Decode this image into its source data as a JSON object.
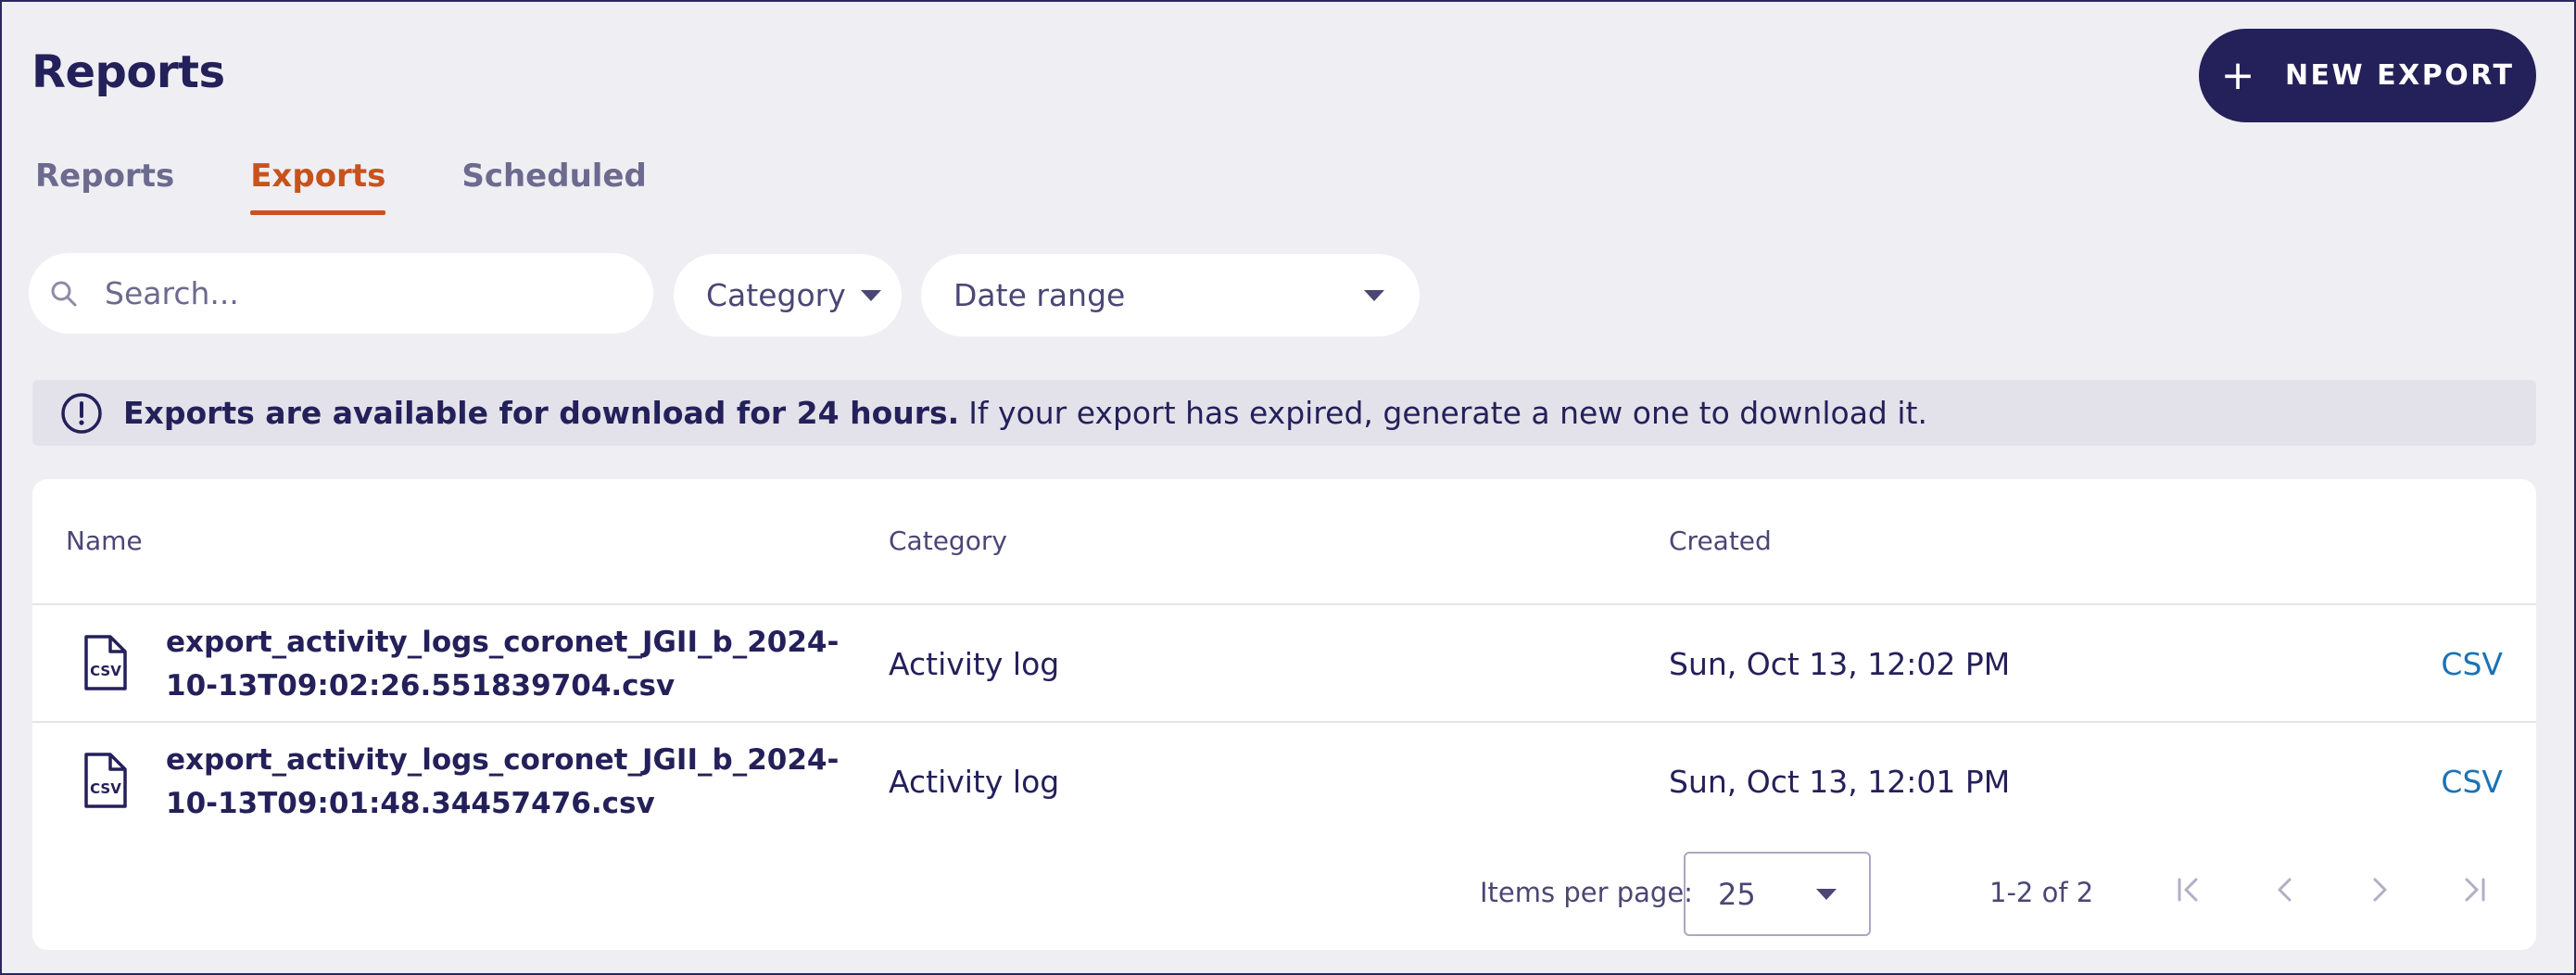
{
  "header": {
    "title": "Reports",
    "new_export_label": "NEW EXPORT"
  },
  "tabs": [
    {
      "label": "Reports",
      "active": false
    },
    {
      "label": "Exports",
      "active": true
    },
    {
      "label": "Scheduled",
      "active": false
    }
  ],
  "filters": {
    "search_placeholder": "Search...",
    "category_label": "Category",
    "date_range_label": "Date range"
  },
  "banner": {
    "bold_text": "Exports are available for download for 24 hours.",
    "text": "If your export has expired, generate a new one to download it."
  },
  "table": {
    "columns": [
      "Name",
      "Category",
      "Created"
    ],
    "rows": [
      {
        "name": "export_activity_logs_coronet_JGII_b_2024-10-13T09:02:26.551839704.csv",
        "category": "Activity log",
        "created": "Sun, Oct 13, 12:02 PM",
        "action": "CSV"
      },
      {
        "name": "export_activity_logs_coronet_JGII_b_2024-10-13T09:01:48.34457476.csv",
        "category": "Activity log",
        "created": "Sun, Oct 13, 12:01 PM",
        "action": "CSV"
      }
    ]
  },
  "pagination": {
    "items_per_page_label": "Items per page:",
    "page_size": "25",
    "range": "1-2 of 2"
  },
  "colors": {
    "primary": "#24205a",
    "accent": "#c9521c",
    "link": "#1a73b5",
    "background": "#efeef3"
  }
}
